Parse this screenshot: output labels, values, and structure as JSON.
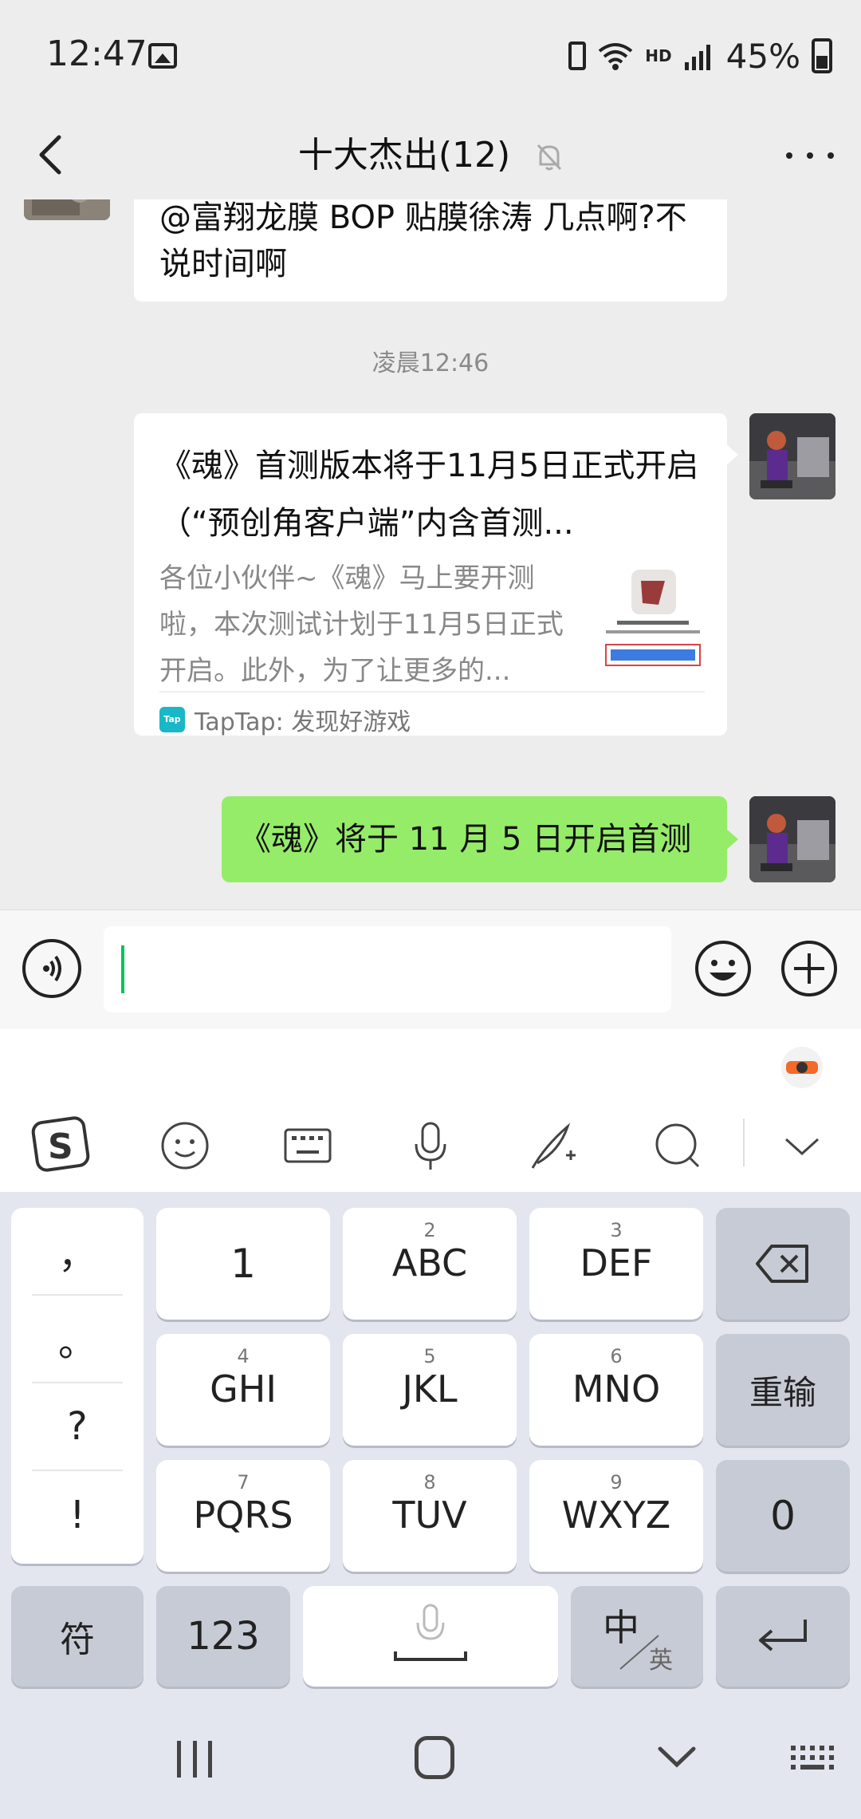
{
  "status_bar": {
    "time": "12:47",
    "network_label": "HD",
    "battery_percent": "45%",
    "battery_level": 0.45
  },
  "header": {
    "title": "十大杰出(12)",
    "muted": true
  },
  "chat": {
    "messages": [
      {
        "type": "text",
        "side": "left",
        "text": "@富翔龙膜 BOP 贴膜徐涛  几点啊?不说时间啊"
      },
      {
        "type": "time",
        "text": "凌晨12:46"
      },
      {
        "type": "link_card",
        "side": "right",
        "title": "《魂》首测版本将于11月5日正式开启（“预创角客户端”内含首测...",
        "description": "各位小伙伴~《魂》马上要开测啦，本次测试计划于11月5日正式开启。此外，为了让更多的...",
        "source_icon": "Tap",
        "source": "TapTap: 发现好游戏"
      },
      {
        "type": "text",
        "side": "right",
        "text": "《魂》将于 11 月 5 日开启首测"
      }
    ]
  },
  "input_bar": {
    "value": ""
  },
  "keyboard": {
    "punctuation": [
      "，",
      "。",
      "?",
      "!"
    ],
    "rows": [
      [
        {
          "num": "",
          "label": "1"
        },
        {
          "num": "2",
          "label": "ABC"
        },
        {
          "num": "3",
          "label": "DEF"
        }
      ],
      [
        {
          "num": "4",
          "label": "GHI"
        },
        {
          "num": "5",
          "label": "JKL"
        },
        {
          "num": "6",
          "label": "MNO"
        }
      ],
      [
        {
          "num": "7",
          "label": "PQRS"
        },
        {
          "num": "8",
          "label": "TUV"
        },
        {
          "num": "9",
          "label": "WXYZ"
        }
      ]
    ],
    "reset_label": "重输",
    "zero_label": "0",
    "symbol_label": "符",
    "numeric_label": "123",
    "lang_main": "中",
    "lang_sub": "英"
  },
  "colors": {
    "background": "#ededed",
    "sent_bubble": "#95ec69",
    "caret": "#07c160",
    "keyboard_bg": "#e3e6ee",
    "taptap": "#19b7c8"
  }
}
